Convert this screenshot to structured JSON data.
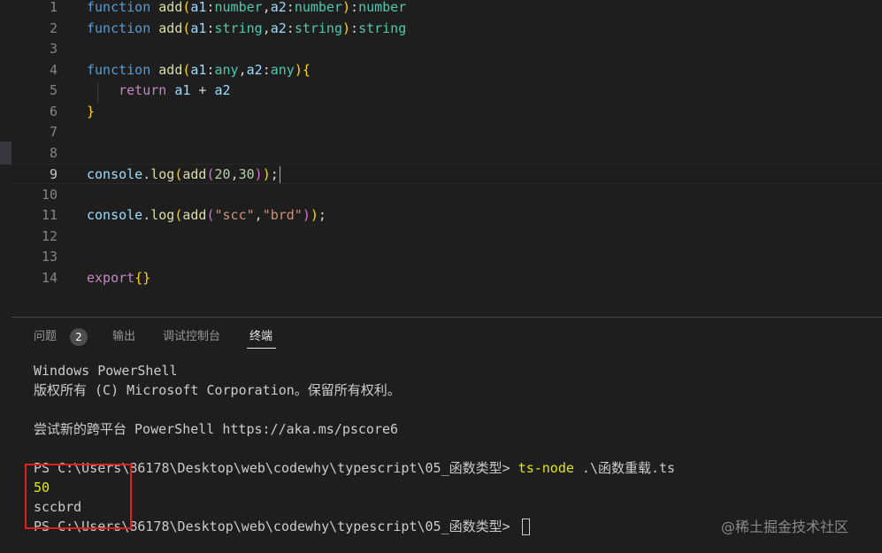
{
  "editor": {
    "line_numbers": [
      "1",
      "2",
      "3",
      "4",
      "5",
      "6",
      "7",
      "8",
      "9",
      "10",
      "11",
      "12",
      "13",
      "14"
    ],
    "active_line": "9",
    "lines": [
      [
        {
          "t": "function",
          "c": "kw"
        },
        {
          "t": " ",
          "c": "plain"
        },
        {
          "t": "add",
          "c": "fn"
        },
        {
          "t": "(",
          "c": "brk"
        },
        {
          "t": "a1",
          "c": "pm"
        },
        {
          "t": ":",
          "c": "plain"
        },
        {
          "t": "number",
          "c": "ty"
        },
        {
          "t": ",",
          "c": "plain"
        },
        {
          "t": "a2",
          "c": "pm"
        },
        {
          "t": ":",
          "c": "plain"
        },
        {
          "t": "number",
          "c": "ty"
        },
        {
          "t": ")",
          "c": "brk"
        },
        {
          "t": ":",
          "c": "plain"
        },
        {
          "t": "number",
          "c": "ty"
        }
      ],
      [
        {
          "t": "function",
          "c": "kw"
        },
        {
          "t": " ",
          "c": "plain"
        },
        {
          "t": "add",
          "c": "fn"
        },
        {
          "t": "(",
          "c": "brk"
        },
        {
          "t": "a1",
          "c": "pm"
        },
        {
          "t": ":",
          "c": "plain"
        },
        {
          "t": "string",
          "c": "ty"
        },
        {
          "t": ",",
          "c": "plain"
        },
        {
          "t": "a2",
          "c": "pm"
        },
        {
          "t": ":",
          "c": "plain"
        },
        {
          "t": "string",
          "c": "ty"
        },
        {
          "t": ")",
          "c": "brk"
        },
        {
          "t": ":",
          "c": "plain"
        },
        {
          "t": "string",
          "c": "ty"
        }
      ],
      [],
      [
        {
          "t": "function",
          "c": "kw"
        },
        {
          "t": " ",
          "c": "plain"
        },
        {
          "t": "add",
          "c": "fn"
        },
        {
          "t": "(",
          "c": "brk"
        },
        {
          "t": "a1",
          "c": "pm"
        },
        {
          "t": ":",
          "c": "plain"
        },
        {
          "t": "any",
          "c": "ty"
        },
        {
          "t": ",",
          "c": "plain"
        },
        {
          "t": "a2",
          "c": "pm"
        },
        {
          "t": ":",
          "c": "plain"
        },
        {
          "t": "any",
          "c": "ty"
        },
        {
          "t": ")",
          "c": "brk"
        },
        {
          "t": "{",
          "c": "brk"
        }
      ],
      [
        {
          "t": "    ",
          "c": "plain"
        },
        {
          "t": "return",
          "c": "kwc"
        },
        {
          "t": " ",
          "c": "plain"
        },
        {
          "t": "a1",
          "c": "pm"
        },
        {
          "t": " + ",
          "c": "plain"
        },
        {
          "t": "a2",
          "c": "pm"
        }
      ],
      [
        {
          "t": "}",
          "c": "brk"
        }
      ],
      [],
      [],
      [
        {
          "t": "console",
          "c": "pm"
        },
        {
          "t": ".",
          "c": "plain"
        },
        {
          "t": "log",
          "c": "fn"
        },
        {
          "t": "(",
          "c": "brk"
        },
        {
          "t": "add",
          "c": "fn"
        },
        {
          "t": "(",
          "c": "brk2"
        },
        {
          "t": "20",
          "c": "num"
        },
        {
          "t": ",",
          "c": "plain"
        },
        {
          "t": "30",
          "c": "num"
        },
        {
          "t": ")",
          "c": "brk2"
        },
        {
          "t": ")",
          "c": "brk"
        },
        {
          "t": ";",
          "c": "plain"
        }
      ],
      [],
      [
        {
          "t": "console",
          "c": "pm"
        },
        {
          "t": ".",
          "c": "plain"
        },
        {
          "t": "log",
          "c": "fn"
        },
        {
          "t": "(",
          "c": "brk"
        },
        {
          "t": "add",
          "c": "fn"
        },
        {
          "t": "(",
          "c": "brk2"
        },
        {
          "t": "\"scc\"",
          "c": "str"
        },
        {
          "t": ",",
          "c": "plain"
        },
        {
          "t": "\"brd\"",
          "c": "str"
        },
        {
          "t": ")",
          "c": "brk2"
        },
        {
          "t": ")",
          "c": "brk"
        },
        {
          "t": ";",
          "c": "plain"
        }
      ],
      [],
      [],
      [
        {
          "t": "export",
          "c": "kwc"
        },
        {
          "t": "{}",
          "c": "brk"
        }
      ]
    ]
  },
  "panel": {
    "tabs": [
      {
        "label": "问题",
        "badge": "2"
      },
      {
        "label": "输出"
      },
      {
        "label": "调试控制台"
      },
      {
        "label": "终端",
        "active": true
      }
    ]
  },
  "terminal": {
    "lines": [
      "Windows PowerShell",
      "版权所有 (C) Microsoft Corporation。保留所有权利。",
      "",
      "尝试新的跨平台 PowerShell https://aka.ms/pscore6",
      ""
    ],
    "prompt1": "PS C:\\Users\\86178\\Desktop\\web\\codewhy\\typescript\\05_函数类型> ",
    "command": "ts-node",
    "command_arg": " .\\函数重载.ts",
    "output": [
      "50",
      "sccbrd"
    ],
    "prompt2": "PS C:\\Users\\86178\\Desktop\\web\\codewhy\\typescript\\05_函数类型> "
  },
  "watermark": "@稀土掘金技术社区",
  "colors": {
    "background": "#1e1e1e",
    "highlight_box": "#e0201f",
    "command_yellow": "#e5e510"
  }
}
